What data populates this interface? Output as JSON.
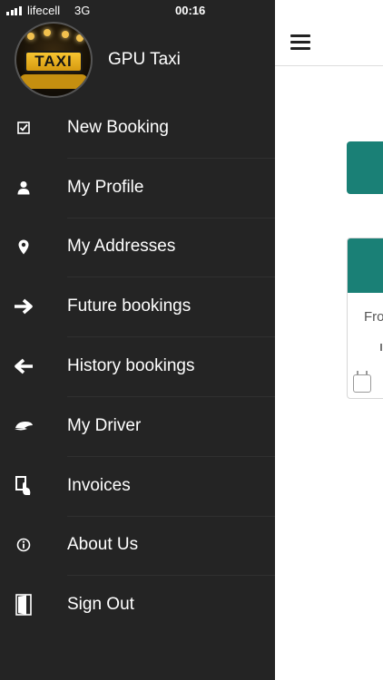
{
  "status_bar": {
    "carrier": "lifecell",
    "network": "3G",
    "time": "00:16"
  },
  "drawer": {
    "app_name": "GPU Taxi",
    "logo_text": "TAXI",
    "menu": [
      {
        "label": "New Booking",
        "icon": "checkbox-icon"
      },
      {
        "label": "My Profile",
        "icon": "person-icon"
      },
      {
        "label": "My Addresses",
        "icon": "location-pin-icon"
      },
      {
        "label": "Future bookings",
        "icon": "arrow-right-icon"
      },
      {
        "label": "History bookings",
        "icon": "arrow-left-icon"
      },
      {
        "label": "My Driver",
        "icon": "driver-cap-icon"
      },
      {
        "label": "Invoices",
        "icon": "invoice-icon"
      },
      {
        "label": "About Us",
        "icon": "info-icon"
      },
      {
        "label": "Sign Out",
        "icon": "door-icon"
      }
    ]
  },
  "main": {
    "card_from_text": "Fro"
  },
  "colors": {
    "drawer_bg": "#242424",
    "accent_teal": "#1a8076",
    "text_white": "#ffffff"
  }
}
